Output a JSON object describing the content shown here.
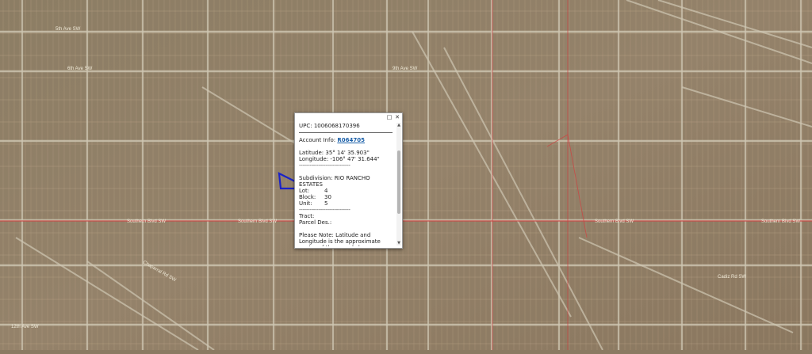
{
  "map": {
    "road_labels": [
      "5th Ave SW",
      "6th Ave SW",
      "9th Ave SW",
      "Southern Blvd SW",
      "Southern Blvd SW",
      "Southern Blvd SW",
      "Southern Blvd SW",
      "Cadiz Rd SW",
      "Chaparral Rd SW",
      "12th Ave SW"
    ],
    "colors": {
      "parcel_line": "#c6ad8f",
      "road": "#cfc7b3",
      "boundary": "#d04040",
      "selected_parcel": "#1a22c8"
    }
  },
  "popup": {
    "upc": "UPC: 1006068170396",
    "account_label": "Account Info:",
    "account_link": "R064705",
    "latitude": "Latitude: 35° 14' 35.903\"",
    "longitude": "Longitude: -106° 47' 31.644\"",
    "dashes": "-----------------------------",
    "subdivision_label": "Subdivision:",
    "subdivision_value": "RIO RANCHO ESTATES",
    "lot_label": "Lot:",
    "lot_value": "4",
    "block_label": "Block:",
    "block_value": "30",
    "unit_label": "Unit:",
    "unit_value": "5",
    "tract_label": "Tract:",
    "parcel_label": "Parcel Des.:",
    "note": "Please Note: Latitude and Longitude is the approximate center of the parcel shown.",
    "buttons": {
      "maximize": "□",
      "close": "✕"
    },
    "scroll": {
      "up": "▲",
      "down": "▼"
    }
  }
}
